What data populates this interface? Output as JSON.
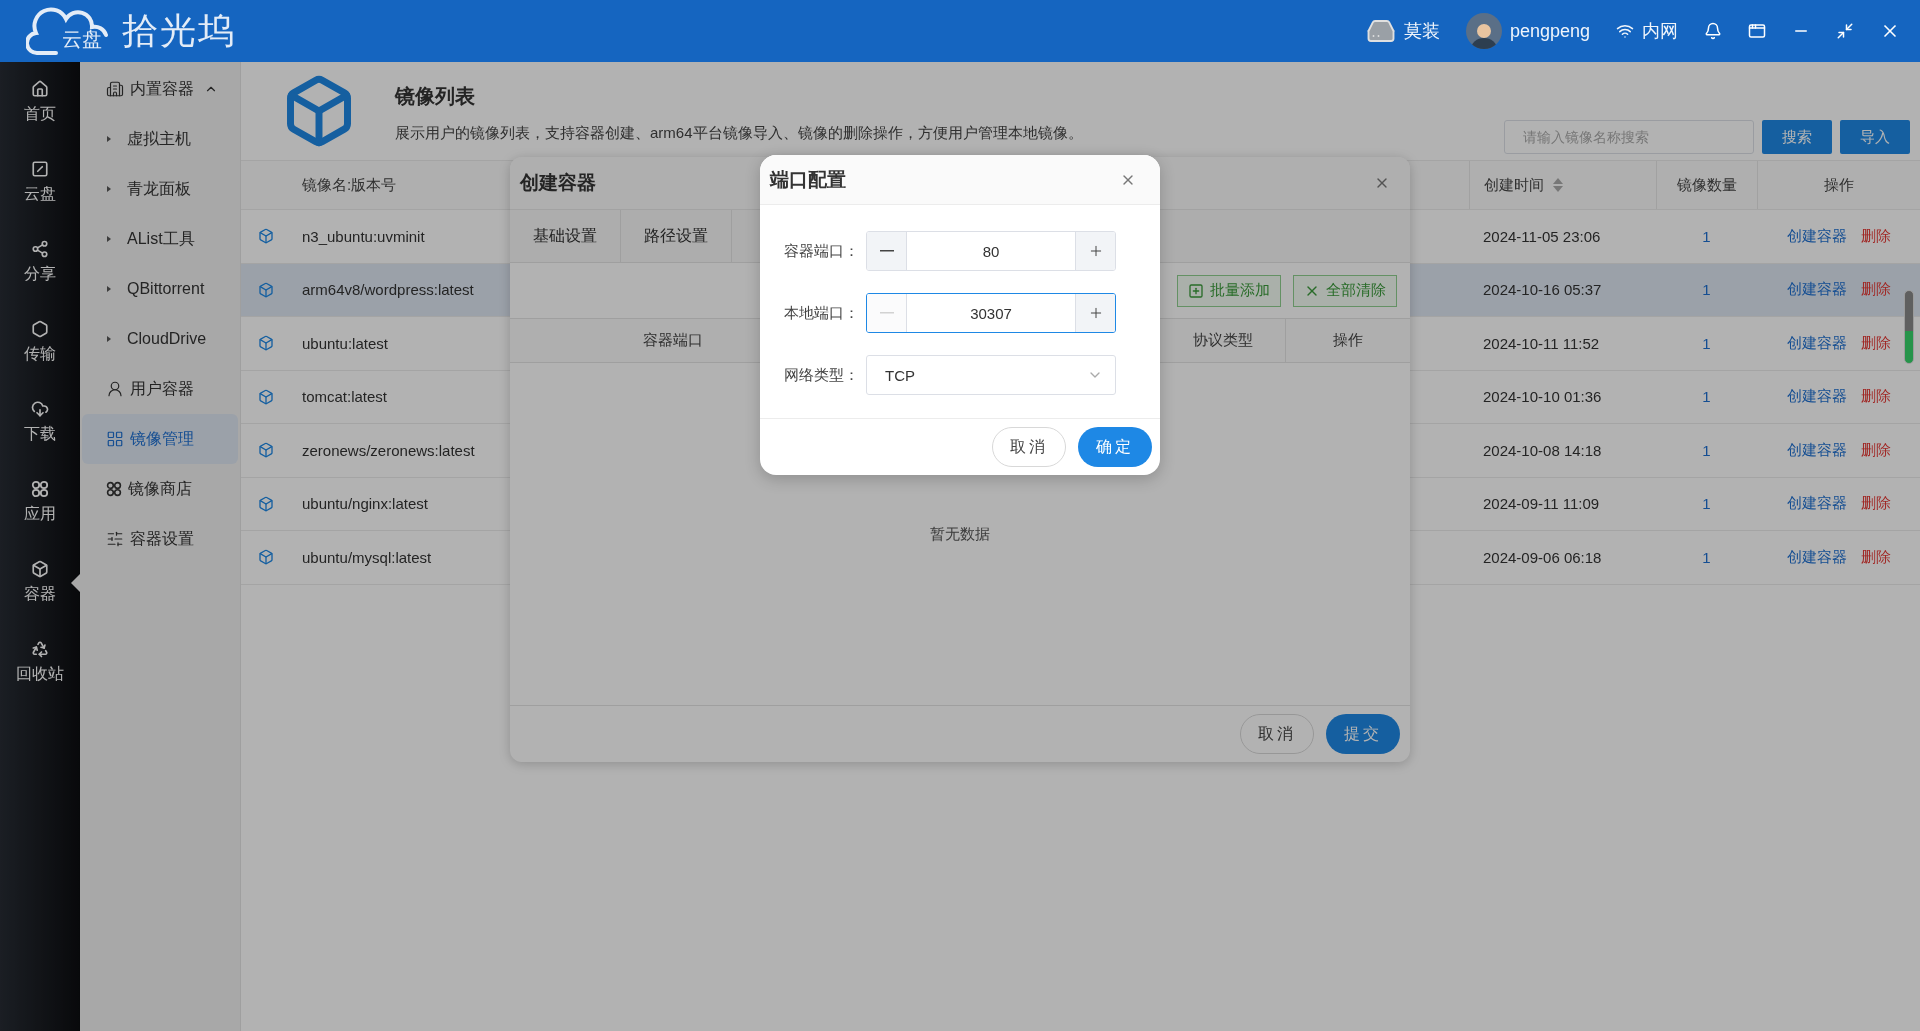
{
  "app": {
    "logo_badge": "云盘",
    "logo_text": "拾光坞"
  },
  "top_bar": {
    "device": "莫装",
    "user": "pengpeng",
    "network": "内网"
  },
  "rail": [
    {
      "label": "首页",
      "selected": false
    },
    {
      "label": "云盘",
      "selected": false
    },
    {
      "label": "分享",
      "selected": false
    },
    {
      "label": "传输",
      "selected": false
    },
    {
      "label": "下载",
      "selected": false
    },
    {
      "label": "应用",
      "selected": false
    },
    {
      "label": "容器",
      "selected": true
    },
    {
      "label": "回收站",
      "selected": false
    }
  ],
  "submenu": [
    {
      "label": "内置容器",
      "expanded": true,
      "selected": false,
      "children": [
        {
          "label": "虚拟主机",
          "selected": false
        },
        {
          "label": "青龙面板",
          "selected": false
        },
        {
          "label": "AList工具",
          "selected": false
        },
        {
          "label": "QBittorrent",
          "selected": false
        },
        {
          "label": "CloudDrive",
          "selected": false
        }
      ]
    },
    {
      "label": "用户容器",
      "selected": false
    },
    {
      "label": "镜像管理",
      "selected": true
    },
    {
      "label": "镜像商店",
      "selected": false
    },
    {
      "label": "容器设置",
      "selected": false
    }
  ],
  "page": {
    "title": "镜像列表",
    "description": "展示用户的镜像列表，支持容器创建、arm64平台镜像导入、镜像的删除操作，方便用户管理本地镜像。",
    "search": {
      "placeholder": "请输入镜像名称搜索"
    },
    "buttons": [
      "搜索",
      "导入"
    ]
  },
  "table": {
    "columns": [
      {
        "label": "镜像名:版本号",
        "sortable": false
      },
      {
        "label": "创建时间",
        "sortable": true
      },
      {
        "label": "镜像数量",
        "sortable": false
      },
      {
        "label": "操作",
        "sortable": false
      }
    ],
    "rows": [
      {
        "name": "n3_ubuntu:uvminit",
        "created": "2024-11-05 23:06",
        "count": "1",
        "actions": [
          "创建容器",
          "删除"
        ],
        "selected": false
      },
      {
        "name": "arm64v8/wordpress:latest",
        "created": "2024-10-16 05:37",
        "count": "1",
        "actions": [
          "创建容器",
          "删除"
        ],
        "selected": true
      },
      {
        "name": "ubuntu:latest",
        "created": "2024-10-11 11:52",
        "count": "1",
        "actions": [
          "创建容器",
          "删除"
        ],
        "selected": false
      },
      {
        "name": "tomcat:latest",
        "created": "2024-10-10 01:36",
        "count": "1",
        "actions": [
          "创建容器",
          "删除"
        ],
        "selected": false
      },
      {
        "name": "zeronews/zeronews:latest",
        "created": "2024-10-08 14:18",
        "count": "1",
        "actions": [
          "创建容器",
          "删除"
        ],
        "selected": false
      },
      {
        "name": "ubuntu/nginx:latest",
        "created": "2024-09-11 11:09",
        "count": "1",
        "actions": [
          "创建容器",
          "删除"
        ],
        "selected": false
      },
      {
        "name": "ubuntu/mysql:latest",
        "created": "2024-09-06 06:18",
        "count": "1",
        "actions": [
          "创建容器",
          "删除"
        ],
        "selected": false
      }
    ]
  },
  "create_dialog": {
    "title": "创建容器",
    "tabs": [
      "基础设置",
      "路径设置"
    ],
    "toolbar_buttons": [
      "批量添加",
      "全部清除"
    ],
    "columns": [
      "容器端口",
      "协议类型",
      "操作"
    ],
    "empty_text": "暂无数据",
    "buttons": [
      {
        "label": "取消",
        "kind": "secondary"
      },
      {
        "label": "提交",
        "kind": "primary"
      }
    ]
  },
  "port_dialog": {
    "title": "端口配置",
    "fields": [
      {
        "kind": "number",
        "label": "容器端口：",
        "value": "80",
        "focused": false,
        "decrement_disabled": false
      },
      {
        "kind": "number",
        "label": "本地端口：",
        "value": "30307",
        "focused": true,
        "decrement_disabled": true
      },
      {
        "kind": "select",
        "label": "网络类型：",
        "value": "TCP"
      }
    ],
    "buttons": [
      {
        "label": "取消",
        "kind": "secondary"
      },
      {
        "label": "确定",
        "kind": "primary"
      }
    ]
  }
}
